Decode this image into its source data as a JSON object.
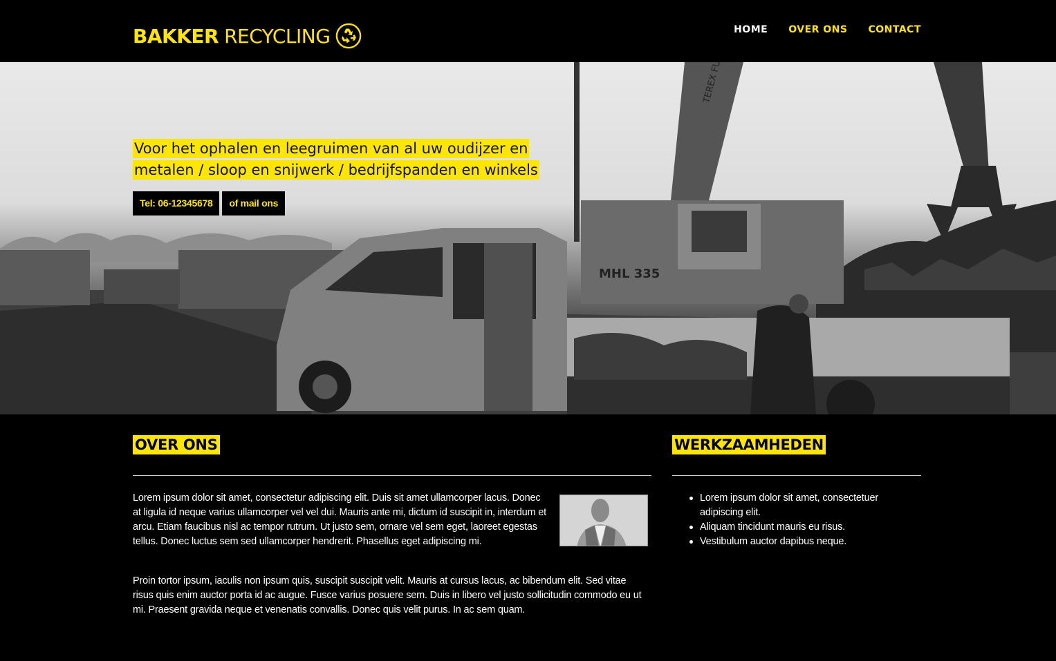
{
  "brand": {
    "bold": "BAKKER",
    "light": "RECYCLING",
    "icon": "recycle-icon",
    "accent": "#ffe600"
  },
  "nav": [
    {
      "label": "HOME",
      "active": true
    },
    {
      "label": "OVER ONS",
      "active": false
    },
    {
      "label": "CONTACT",
      "active": false
    }
  ],
  "hero": {
    "line1": "Voor het ophalen en leegruimen van al uw oudijzer en",
    "line2": "metalen / sloop en snijwerk / bedrijfspanden en winkels",
    "phone_button": "Tel: 06-12345678",
    "mail_button": "of mail ons"
  },
  "about": {
    "title": "OVER ONS",
    "paragraph1": "Lorem ipsum dolor sit amet, consectetur adipiscing elit. Duis sit amet ullamcorper lacus. Donec at ligula id neque varius ullamcorper vel vel dui. Mauris ante mi, dictum id suscipit in, interdum et arcu. Etiam faucibus nisl ac tempor rutrum. Ut justo sem, ornare vel sem eget, laoreet egestas tellus. Donec luctus sem sed ullamcorper hendrerit. Phasellus eget adipiscing mi.",
    "paragraph2": "Proin tortor ipsum, iaculis non ipsum quis, suscipit suscipit velit. Mauris at cursus lacus, ac bibendum elit. Sed vitae risus quis enim auctor porta id ac augue. Fusce varius posuere sem. Duis in libero vel justo sollicitudin commodo eu ut mi. Praesent gravida neque et venenatis convallis. Donec quis velit purus. In ac sem quam."
  },
  "work": {
    "title": "WERKZAAMHEDEN",
    "items": [
      "Lorem ipsum dolor sit amet, consectetuer adipiscing elit.",
      "Aliquam tincidunt mauris eu risus.",
      "Vestibulum auctor dapibus neque."
    ]
  },
  "hero_photo_labels": {
    "crane_brand": "TEREX FUCHS",
    "crane_model": "MHL 335"
  }
}
